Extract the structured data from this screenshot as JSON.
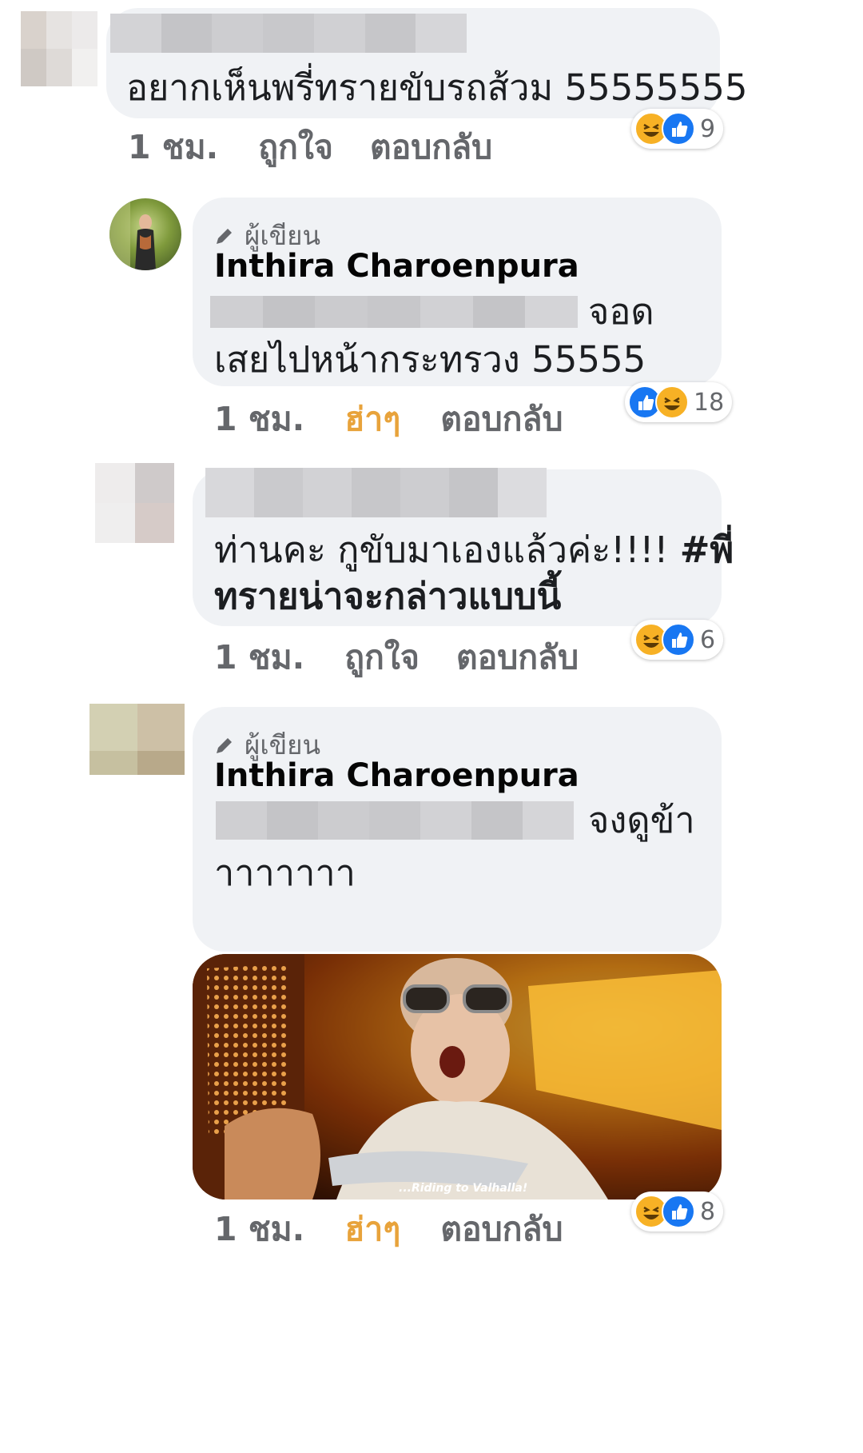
{
  "comments": [
    {
      "text_line1": "อยากเห็นพรี่ทรายขับรถส้วม 55555555",
      "time": "1 ชม.",
      "action": "ถูกใจ",
      "reply": "ตอบกลับ",
      "reactions": [
        "haha",
        "like"
      ],
      "reaction_count": "9"
    },
    {
      "badge": "ผู้เขียน",
      "author": "Inthira Charoenpura",
      "text_line1_tail": "จอด",
      "text_line2": "เสยไปหน้ากระทรวง 55555",
      "time": "1 ชม.",
      "action": "ฮ่าๆ",
      "reply": "ตอบกลับ",
      "reactions": [
        "like",
        "haha"
      ],
      "reaction_count": "18"
    },
    {
      "text_line1": "ท่านคะ กูขับมาเองแล้วค่ะ!!!! ",
      "hashtag_line1": "#พี่",
      "hashtag_line2": "ทรายน่าจะกล่าวแบบนี้",
      "time": "1 ชม.",
      "action": "ถูกใจ",
      "reply": "ตอบกลับ",
      "reactions": [
        "haha",
        "like"
      ],
      "reaction_count": "6"
    },
    {
      "badge": "ผู้เขียน",
      "author": "Inthira Charoenpura",
      "text_line1_tail": "จงดูข้า",
      "text_line2": "าาาาาาา",
      "gif_caption": "...Riding to Valhalla!",
      "time": "1 ชม.",
      "action": "ฮ่าๆ",
      "reply": "ตอบกลับ",
      "reactions": [
        "haha",
        "like"
      ],
      "reaction_count": "8"
    }
  ],
  "colors": {
    "bubble": "#f0f2f5",
    "meta": "#65676b",
    "haha_active": "#e8a33b",
    "like": "#1877f2",
    "haha": "#f7b125"
  }
}
